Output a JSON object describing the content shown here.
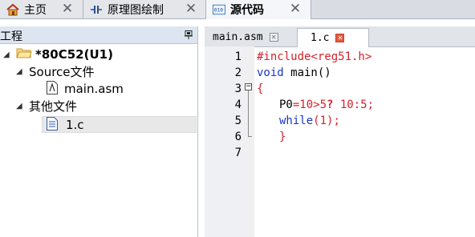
{
  "top_tabs": [
    {
      "label": "主页"
    },
    {
      "label": "原理图绘制"
    },
    {
      "label": "源代码"
    }
  ],
  "project_panel": {
    "title": "工程",
    "tree": {
      "root": "*80C52(U1)",
      "source_folder": "Source文件",
      "source_file": "main.asm",
      "other_folder": "其他文件",
      "other_file": "1.c"
    }
  },
  "editor": {
    "tabs": [
      {
        "label": "main.asm"
      },
      {
        "label": "1.c"
      }
    ],
    "line_numbers": [
      "1",
      "2",
      "3",
      "4",
      "5",
      "6",
      "7"
    ],
    "code": {
      "l1": "#include<reg51.h>",
      "l2_kw": "void",
      "l2_rest": " main()",
      "l3": "{",
      "l4_ident": "P0",
      "l4_expr": "=10>5",
      "l4_q": "?",
      "l4_tail": " 10:5;",
      "l5_kw": "while",
      "l5_rest": "(1);",
      "l6": "}"
    }
  },
  "colors": {
    "preprocessor": "#d8212b",
    "keyword": "#1a35c7",
    "tab_close_active": "#e25b3f"
  }
}
